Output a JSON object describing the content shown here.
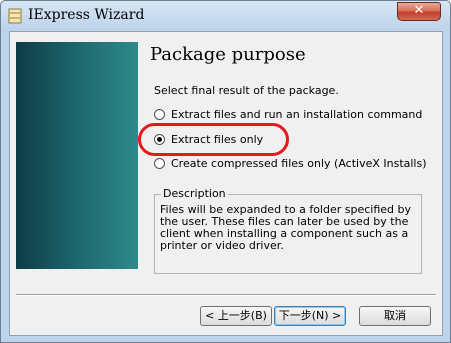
{
  "window": {
    "title": "IExpress Wizard",
    "close_label": "✕"
  },
  "page": {
    "title": "Package purpose",
    "subtitle": "Select final result of the package."
  },
  "options": [
    {
      "label": "Extract files and run an installation command",
      "checked": false
    },
    {
      "label": "Extract files only",
      "checked": true
    },
    {
      "label": "Create compressed files only (ActiveX Installs)",
      "checked": false
    }
  ],
  "description": {
    "legend": "Description",
    "text": "Files will be expanded to a folder specified by the user. These files can later be used by the client when installing a component such as a printer or video driver."
  },
  "buttons": {
    "back": "< 上一步(B)",
    "next": "下一步(N) >",
    "cancel": "取消"
  },
  "colors": {
    "highlight": "#e11b1b",
    "banner": "#1f6b72"
  }
}
